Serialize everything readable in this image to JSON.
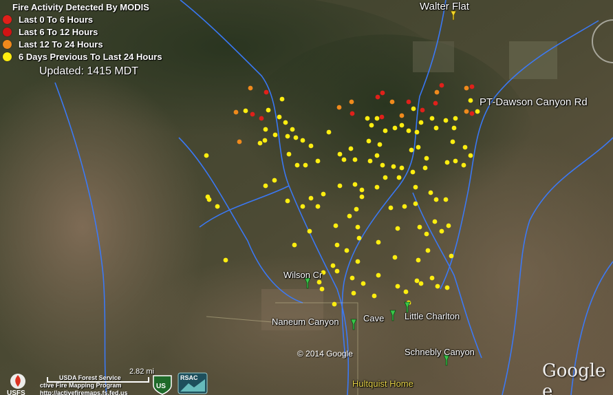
{
  "legend": {
    "title": "Fire Activity Detected By MODIS",
    "items": [
      {
        "label": "Last 0 To 6 Hours",
        "color": "#e0201a"
      },
      {
        "label": "Last 6 To 12 Hours",
        "color": "#d01414"
      },
      {
        "label": "Last 12 To 24 Hours",
        "color": "#f08a1c"
      },
      {
        "label": "6 Days Previous To Last 24 Hours",
        "color": "#ffee10"
      }
    ]
  },
  "updated": "Updated: 1415 MDT",
  "places": [
    {
      "name": "Walter Flat",
      "pin": "yellow"
    },
    {
      "name": "PT-Dawson Canyon Rd",
      "pin": "none"
    },
    {
      "name": "Wilson Cr",
      "pin": "green"
    },
    {
      "name": "Naneum Canyon",
      "pin": "green"
    },
    {
      "name": "Cave",
      "pin": "green"
    },
    {
      "name": "Little Charlton",
      "pin": "green"
    },
    {
      "name": "Schnebly Canyon",
      "pin": "green"
    },
    {
      "name": "Hultquist Home",
      "pin": "none"
    }
  ],
  "copyright": "© 2014 Google",
  "google_logo": "Google e",
  "scale_label": "2.82 mi",
  "footer": {
    "line1": "USDA Forest Service",
    "line2": "ctive Fire Mapping Program",
    "line3": "http://activefiremaps.fs.fed.us"
  },
  "badges": {
    "usfs": "US",
    "rsac": "RSAC",
    "usfs_bottom": "USFS"
  },
  "colors": {
    "river": "#3a7bff",
    "fire_yellow": "#ffee10",
    "fire_orange": "#f08a1c",
    "fire_red": "#e0201a"
  }
}
